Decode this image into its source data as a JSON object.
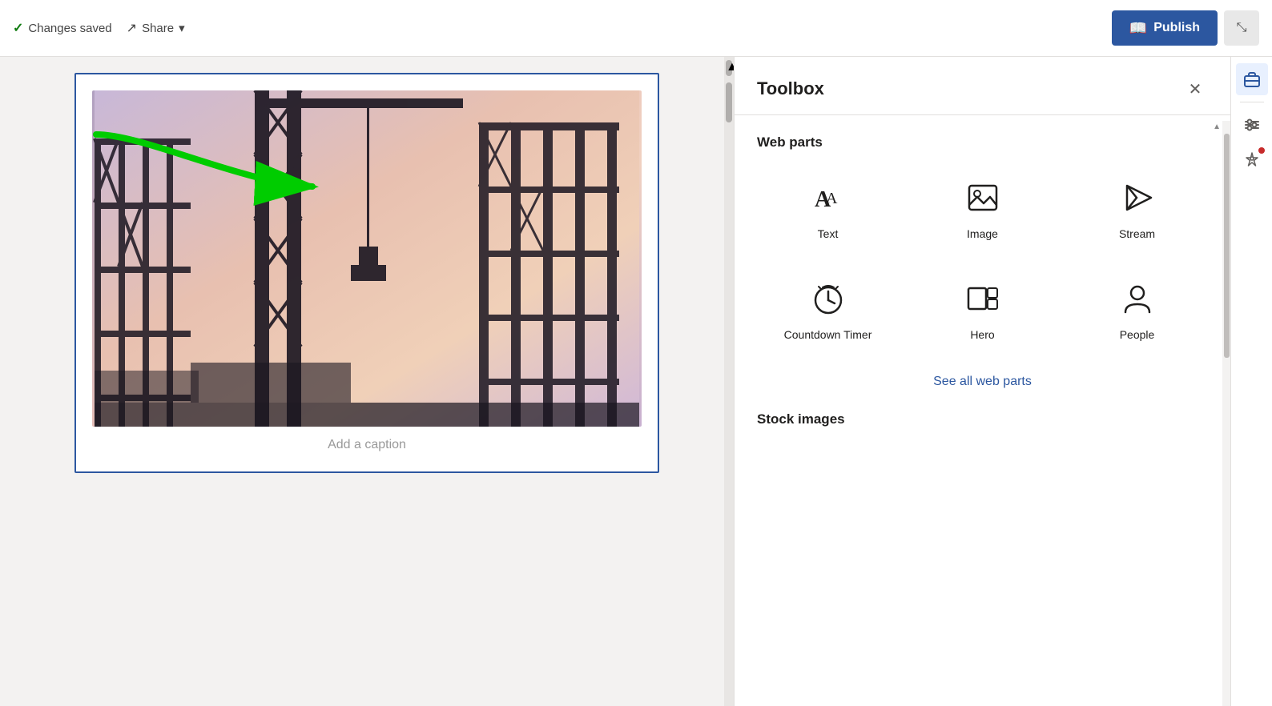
{
  "topbar": {
    "changes_saved": "Changes saved",
    "share_label": "Share",
    "publish_label": "Publish",
    "collapse_icon": "⤡"
  },
  "toolbox": {
    "title": "Toolbox",
    "close_icon": "✕",
    "webparts_section": "Web parts",
    "webparts": [
      {
        "id": "text",
        "label": "Text",
        "icon": "text"
      },
      {
        "id": "image",
        "label": "Image",
        "icon": "image"
      },
      {
        "id": "stream",
        "label": "Stream",
        "icon": "stream"
      },
      {
        "id": "countdown",
        "label": "Countdown Timer",
        "icon": "countdown"
      },
      {
        "id": "hero",
        "label": "Hero",
        "icon": "hero"
      },
      {
        "id": "people",
        "label": "People",
        "icon": "people"
      }
    ],
    "see_all_label": "See all web parts",
    "stock_images_section": "Stock images"
  },
  "canvas": {
    "caption_placeholder": "Add a caption"
  },
  "sidebar": {
    "toolbox_icon": "toolbox",
    "settings_icon": "settings",
    "ai_icon": "ai-sparkle"
  }
}
